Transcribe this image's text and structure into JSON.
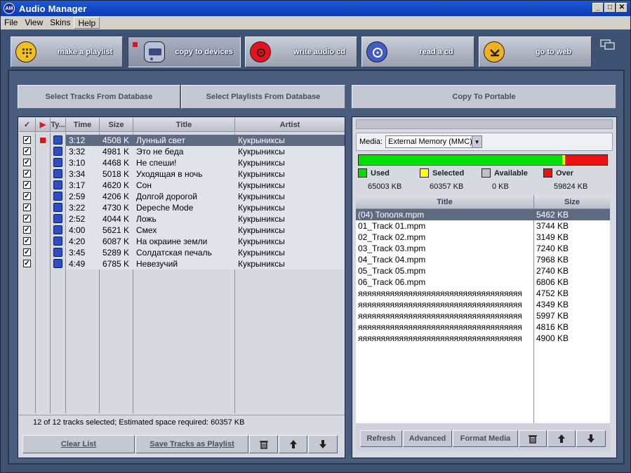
{
  "window": {
    "title": "Audio Manager",
    "icon_text": "AM",
    "controls": [
      "_",
      "□",
      "✕"
    ]
  },
  "menu": [
    "File",
    "View",
    "Skins",
    "Help"
  ],
  "toolbar": {
    "buttons": [
      {
        "label": "make a playlist"
      },
      {
        "label": "copy to devices"
      },
      {
        "label": "write audio cd"
      },
      {
        "label": "read a cd"
      },
      {
        "label": "go to web"
      }
    ]
  },
  "actions": {
    "select_tracks": "Select Tracks From Database",
    "select_playlists": "Select Playlists From Database",
    "copy_to_portable": "Copy To Portable"
  },
  "tracks": {
    "columns": [
      "✓",
      "▶",
      "Ty...",
      "Time",
      "Size",
      "Title",
      "Artist"
    ],
    "rows": [
      {
        "time": "3:12",
        "size": "4508 K",
        "title": "Лунный свет",
        "artist": "Кукрыниксы"
      },
      {
        "time": "3:32",
        "size": "4981 K",
        "title": "Это не беда",
        "artist": "Кукрыниксы"
      },
      {
        "time": "3:10",
        "size": "4468 K",
        "title": "Не спеши!",
        "artist": "Кукрыниксы"
      },
      {
        "time": "3:34",
        "size": "5018 K",
        "title": "Уходящая в ночь",
        "artist": "Кукрыниксы"
      },
      {
        "time": "3:17",
        "size": "4620 K",
        "title": "Сон",
        "artist": "Кукрыниксы"
      },
      {
        "time": "2:59",
        "size": "4206 K",
        "title": "Долгой дорогой",
        "artist": "Кукрыниксы"
      },
      {
        "time": "3:22",
        "size": "4730 K",
        "title": "Depeche Mode",
        "artist": "Кукрыниксы"
      },
      {
        "time": "2:52",
        "size": "4044 K",
        "title": "Ложь",
        "artist": "Кукрыниксы"
      },
      {
        "time": "4:00",
        "size": "5621 K",
        "title": "Смех",
        "artist": "Кукрыниксы"
      },
      {
        "time": "4:20",
        "size": "6087 K",
        "title": "На окраине земли",
        "artist": "Кукрыниксы"
      },
      {
        "time": "3:45",
        "size": "5289 K",
        "title": "Солдатская печаль",
        "artist": "Кукрыниксы"
      },
      {
        "time": "4:49",
        "size": "6785 K",
        "title": "Невезучий",
        "artist": "Кукрыниксы"
      }
    ],
    "status": "12 of 12 tracks selected;  Estimated space required: 60357 KB",
    "clear_list": "Clear List",
    "save_playlist": "Save Tracks as Playlist"
  },
  "device": {
    "media_label": "Media:",
    "media_value": "External Memory (MMC)",
    "capacity": {
      "used_fraction": 0.82,
      "selected_fraction": 0.01,
      "over_fraction": 0.17
    },
    "colors": {
      "used": "#00e000",
      "selected": "#ffff00",
      "available": "#c0c0c0",
      "over": "#ee1111"
    },
    "legend": {
      "used_label": "Used",
      "used_value": "65003 KB",
      "selected_label": "Selected",
      "selected_value": "60357 KB",
      "available_label": "Available",
      "available_value": "0 KB",
      "over_label": "Over",
      "over_value": "59824 KB"
    },
    "columns": [
      "Title",
      "Size"
    ],
    "files": [
      {
        "title": "(04) Тополя.mpm",
        "size": "5462 KB"
      },
      {
        "title": "01_Track 01.mpm",
        "size": "3744 KB"
      },
      {
        "title": "02_Track 02.mpm",
        "size": "3149 KB"
      },
      {
        "title": "03_Track 03.mpm",
        "size": "7240 KB"
      },
      {
        "title": "04_Track 04.mpm",
        "size": "7968 KB"
      },
      {
        "title": "05_Track 05.mpm",
        "size": "2740 KB"
      },
      {
        "title": "06_Track 06.mpm",
        "size": "6806 KB"
      },
      {
        "title": "яяяяяяяяяяяяяяяяяяяяяяяяяяяяяяяяяяяя",
        "size": "4752 KB"
      },
      {
        "title": "яяяяяяяяяяяяяяяяяяяяяяяяяяяяяяяяяяяя",
        "size": "4349 KB"
      },
      {
        "title": "яяяяяяяяяяяяяяяяяяяяяяяяяяяяяяяяяяяя",
        "size": "5997 KB"
      },
      {
        "title": "яяяяяяяяяяяяяяяяяяяяяяяяяяяяяяяяяяяя",
        "size": "4816 KB"
      },
      {
        "title": "яяяяяяяяяяяяяяяяяяяяяяяяяяяяяяяяяяяя",
        "size": "4900 KB"
      }
    ],
    "refresh": "Refresh",
    "advanced": "Advanced",
    "format_media": "Format Media"
  }
}
